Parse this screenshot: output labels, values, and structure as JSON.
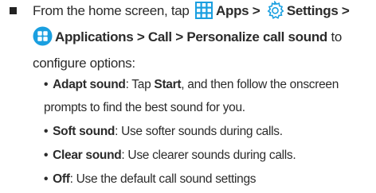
{
  "instruction": {
    "prefix": "From the home screen, tap",
    "apps_label": "Apps >",
    "settings_label": "Settings >",
    "applications_label": "Applications > Call > Personalize call sound",
    "suffix": " to",
    "line3": "configure options:"
  },
  "icons": [
    "apps-grid-icon",
    "settings-gear-icon",
    "applications-icon"
  ],
  "accent_color": "#1a9fe0",
  "options": [
    {
      "term": "Adapt sound",
      "sep": ": Tap ",
      "bold2": "Start",
      "rest": ", and then follow the onscreen",
      "cont": "prompts to find the best sound for you."
    },
    {
      "term": "Soft sound",
      "sep": ": Use softer sounds during calls."
    },
    {
      "term": "Clear sound",
      "sep": ": Use clearer sounds during calls."
    },
    {
      "term": "Off",
      "sep": ": Use the default call sound settings"
    }
  ]
}
